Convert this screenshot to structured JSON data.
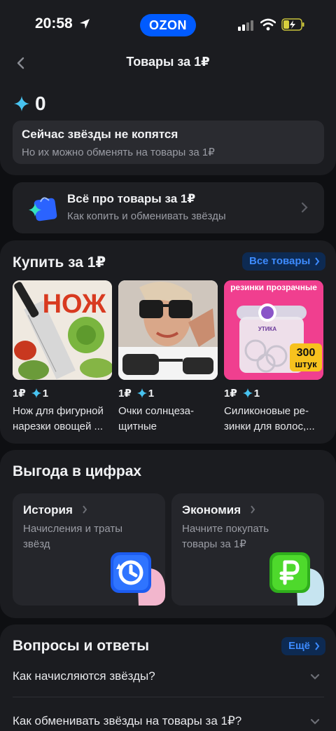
{
  "status_bar": {
    "time": "20:58",
    "brand": "OZON"
  },
  "header": {
    "title": "Товары за 1₽",
    "stars_count": "0",
    "notice_title": "Сейчас звёзды не копятся",
    "notice_subtitle": "Но их можно обменять на товары за 1₽"
  },
  "info_card": {
    "title": "Всё про товары за 1₽",
    "subtitle": "Как копить и обменивать звёзды"
  },
  "buy_section": {
    "title": "Купить за 1₽",
    "all_button": "Все товары",
    "products": [
      {
        "price": "1₽",
        "stars": "1",
        "name": "Нож для фигурной нарезки овощей ...",
        "image_text": "НОЖ"
      },
      {
        "price": "1₽",
        "stars": "1",
        "name": "Очки солнцеза-щитные"
      },
      {
        "price": "1₽",
        "stars": "1",
        "name": "Силиконовые ре-зинки для волос,...",
        "image_text": "резинки прозрачные",
        "badge_number": "300",
        "badge_unit": "штук",
        "jar_label": "УТИКА"
      }
    ]
  },
  "profit_section": {
    "title": "Выгода в цифрах",
    "cards": [
      {
        "title": "История",
        "description": "Начисления и траты звёзд"
      },
      {
        "title": "Экономия",
        "description": "Начните покупать товары за 1₽"
      }
    ]
  },
  "faq_section": {
    "title": "Вопросы и ответы",
    "more_button": "Ещё",
    "items": [
      "Как начисляются звёзды?",
      "Как обменивать звёзды на товары за 1₽?"
    ]
  },
  "colors": {
    "background": "#0e0f12",
    "card": "#1b1c20",
    "accent": "#005bff",
    "link": "#3d8bff"
  }
}
